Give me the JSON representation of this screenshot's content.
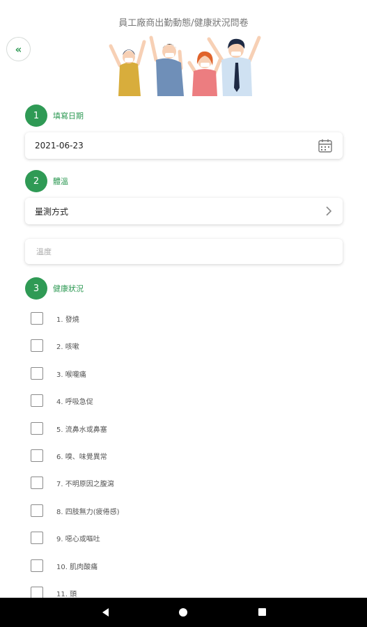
{
  "header": {
    "title": "員工廠商出勤動態/健康狀況問卷",
    "back_icon": "double-chevron-left-icon"
  },
  "colors": {
    "accent": "#2f9a55",
    "skin": "#f7d0b5",
    "shirt_yellow": "#d8ad3c",
    "shirt_blue": "#6f8fb8",
    "shirt_pink": "#ec7d80",
    "shirt_lightblue": "#cfe1f2"
  },
  "steps": [
    {
      "number": "1",
      "label": "填寫日期"
    },
    {
      "number": "2",
      "label": "體溫"
    },
    {
      "number": "3",
      "label": "健康狀況"
    }
  ],
  "date_field": {
    "value": "2021-06-23",
    "icon": "calendar-icon"
  },
  "measure_field": {
    "label": "量測方式",
    "icon": "chevron-right-icon"
  },
  "temperature_field": {
    "placeholder": "溫度",
    "value": ""
  },
  "health_items": [
    {
      "label": "1. 發燒",
      "checked": false
    },
    {
      "label": "2. 咳嗽",
      "checked": false
    },
    {
      "label": "3. 喉嚨痛",
      "checked": false
    },
    {
      "label": "4. 呼吸急促",
      "checked": false
    },
    {
      "label": "5. 流鼻水或鼻塞",
      "checked": false
    },
    {
      "label": "6. 嗅、味覺異常",
      "checked": false
    },
    {
      "label": "7. 不明原因之腹瀉",
      "checked": false
    },
    {
      "label": "8. 四肢無力(疲倦感)",
      "checked": false
    },
    {
      "label": "9. 噁心或嘔吐",
      "checked": false
    },
    {
      "label": "10. 肌肉酸痛",
      "checked": false
    },
    {
      "label": "11. 頭",
      "checked": false
    }
  ],
  "navbar": {
    "back_icon": "nav-back-triangle-icon",
    "home_icon": "nav-home-circle-icon",
    "recents_icon": "nav-recents-square-icon"
  }
}
